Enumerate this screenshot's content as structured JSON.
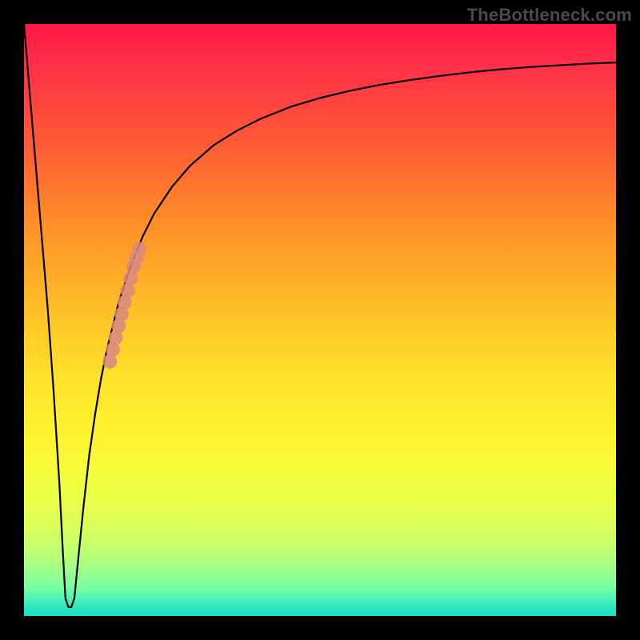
{
  "watermark": "TheBottleneck.com",
  "colors": {
    "frame": "#000000",
    "curve": "#000000",
    "marker": "#d98880",
    "gradient_top": "#ff1744",
    "gradient_bottom": "#18e0c6"
  },
  "chart_data": {
    "type": "line",
    "title": "",
    "xlabel": "",
    "ylabel": "",
    "xlim": [
      0,
      100
    ],
    "ylim": [
      0,
      100
    ],
    "grid": false,
    "legend": false,
    "series": [
      {
        "name": "bottleneck-curve",
        "x": [
          0,
          1,
          2,
          3,
          4,
          5,
          6,
          6.5,
          7,
          7.5,
          8,
          8.5,
          9,
          10,
          11,
          12,
          13,
          14,
          16,
          18,
          20,
          22,
          25,
          28,
          32,
          36,
          40,
          45,
          50,
          55,
          60,
          65,
          70,
          75,
          80,
          85,
          90,
          95,
          100
        ],
        "y": [
          100,
          88,
          76,
          64,
          52,
          38,
          22,
          12,
          3,
          1.5,
          1.5,
          3,
          8,
          18,
          27,
          34,
          40,
          45,
          53,
          59,
          64,
          68,
          72.5,
          76,
          79.5,
          82,
          84,
          86,
          87.5,
          88.7,
          89.7,
          90.5,
          91.2,
          91.8,
          92.3,
          92.7,
          93,
          93.3,
          93.5
        ]
      }
    ],
    "highlight_markers": {
      "name": "highlighted-range",
      "points": [
        {
          "x": 14.5,
          "y": 43
        },
        {
          "x": 15.0,
          "y": 45
        },
        {
          "x": 15.5,
          "y": 47
        },
        {
          "x": 16.0,
          "y": 49
        },
        {
          "x": 16.5,
          "y": 51
        },
        {
          "x": 17.0,
          "y": 53
        },
        {
          "x": 17.5,
          "y": 55
        },
        {
          "x": 18.0,
          "y": 57
        },
        {
          "x": 18.5,
          "y": 59
        },
        {
          "x": 19.0,
          "y": 60.5
        },
        {
          "x": 19.5,
          "y": 62
        }
      ]
    }
  }
}
